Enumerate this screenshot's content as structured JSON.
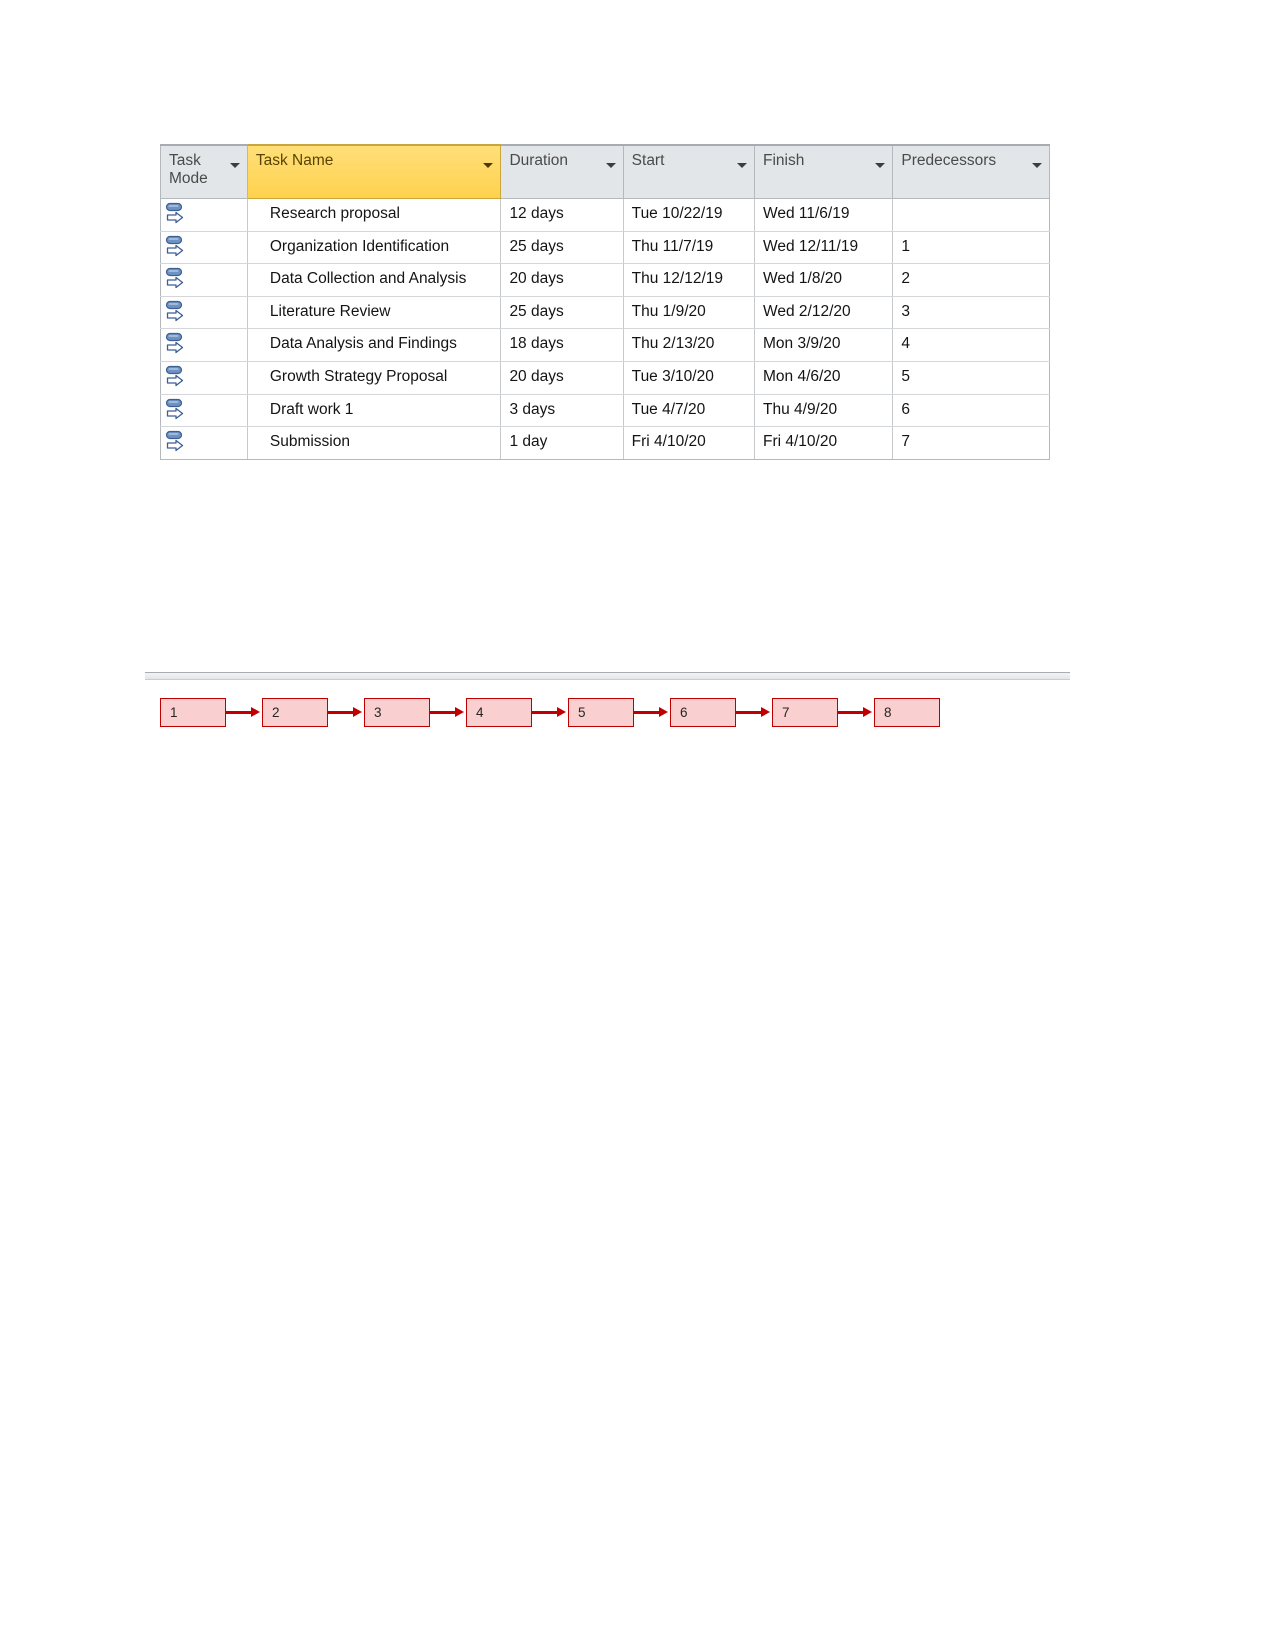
{
  "table": {
    "columns": [
      {
        "key": "mode",
        "label": "Task Mode",
        "highlighted": false,
        "has_filter_caret": true
      },
      {
        "key": "name",
        "label": "Task Name",
        "highlighted": true,
        "has_filter_caret": true
      },
      {
        "key": "duration",
        "label": "Duration",
        "highlighted": false,
        "has_filter_caret": true
      },
      {
        "key": "start",
        "label": "Start",
        "highlighted": false,
        "has_filter_caret": true
      },
      {
        "key": "finish",
        "label": "Finish",
        "highlighted": false,
        "has_filter_caret": true
      },
      {
        "key": "predecessors",
        "label": "Predecessors",
        "highlighted": false,
        "has_filter_caret": true
      }
    ],
    "header_highlight_color": "#ffd24d",
    "header_background_color": "#e2e6e9",
    "task_mode_icon": "auto-scheduled-task-icon",
    "rows": [
      {
        "mode_icon": "auto-scheduled-task-icon",
        "name": "Research proposal",
        "duration": "12 days",
        "start": "Tue 10/22/19",
        "finish": "Wed 11/6/19",
        "predecessors": ""
      },
      {
        "mode_icon": "auto-scheduled-task-icon",
        "name": "Organization Identification",
        "duration": "25 days",
        "start": "Thu 11/7/19",
        "finish": "Wed 12/11/19",
        "predecessors": "1"
      },
      {
        "mode_icon": "auto-scheduled-task-icon",
        "name": "Data Collection and Analysis",
        "duration": "20 days",
        "start": "Thu 12/12/19",
        "finish": "Wed 1/8/20",
        "predecessors": "2"
      },
      {
        "mode_icon": "auto-scheduled-task-icon",
        "name": "Literature Review",
        "duration": "25 days",
        "start": "Thu 1/9/20",
        "finish": "Wed 2/12/20",
        "predecessors": "3"
      },
      {
        "mode_icon": "auto-scheduled-task-icon",
        "name": "Data Analysis and Findings",
        "duration": "18 days",
        "start": "Thu 2/13/20",
        "finish": "Mon 3/9/20",
        "predecessors": "4"
      },
      {
        "mode_icon": "auto-scheduled-task-icon",
        "name": "Growth Strategy Proposal",
        "duration": "20 days",
        "start": "Tue 3/10/20",
        "finish": "Mon 4/6/20",
        "predecessors": "5"
      },
      {
        "mode_icon": "auto-scheduled-task-icon",
        "name": "Draft work 1",
        "duration": "3 days",
        "start": "Tue 4/7/20",
        "finish": "Thu 4/9/20",
        "predecessors": "6"
      },
      {
        "mode_icon": "auto-scheduled-task-icon",
        "name": "Submission",
        "duration": "1 day",
        "start": "Fri 4/10/20",
        "finish": "Fri 4/10/20",
        "predecessors": "7"
      }
    ]
  },
  "network_diagram": {
    "node_fill_color": "#f9cfcf",
    "node_border_color": "#c00000",
    "arrow_color": "#c00000",
    "nodes": [
      {
        "label": "1"
      },
      {
        "label": "2"
      },
      {
        "label": "3"
      },
      {
        "label": "4"
      },
      {
        "label": "5"
      },
      {
        "label": "6"
      },
      {
        "label": "7"
      },
      {
        "label": "8"
      }
    ]
  }
}
